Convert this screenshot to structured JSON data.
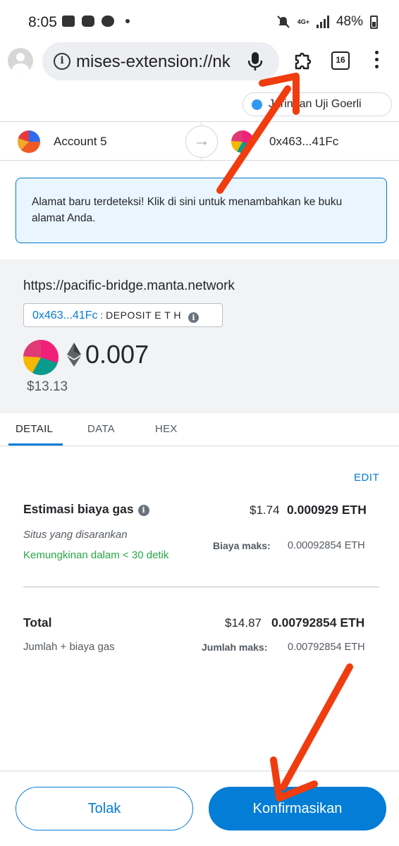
{
  "status_bar": {
    "time": "8:05",
    "network_type": "4G+",
    "battery": "48%"
  },
  "browser": {
    "url": "mises-extension://nk",
    "tab_count": "16"
  },
  "network": {
    "label": "Jaringan Uji Goerli",
    "dot_color": "#3099f2"
  },
  "accounts": {
    "from_name": "Account 5",
    "to_address": "0x463...41Fc"
  },
  "alert": {
    "message": "Alamat baru terdeteksi! Klik di sini untuk menambahkan ke buku alamat Anda."
  },
  "summary": {
    "origin": "https://pacific-bridge.manta.network",
    "method_address": "0x463...41Fc",
    "method_separator": ":",
    "method_name": "DEPOSIT E T H",
    "amount": "0.007",
    "amount_fiat": "$13.13"
  },
  "tabs": [
    {
      "label": "DETAIL"
    },
    {
      "label": "DATA"
    },
    {
      "label": "HEX"
    }
  ],
  "details": {
    "edit_label": "EDIT",
    "gas_label": "Estimasi biaya gas",
    "gas_fiat": "$1.74",
    "gas_eth": "0.000929 ETH",
    "suggested_site": "Situs yang disarankan",
    "likely_time": "Kemungkinan dalam < 30 detik",
    "max_fee_label": "Biaya maks:",
    "max_fee_value": "0.00092854 ETH",
    "total_label": "Total",
    "total_fiat": "$14.87",
    "total_eth": "0.00792854 ETH",
    "total_sub": "Jumlah + biaya gas",
    "max_amount_label": "Jumlah maks:",
    "max_amount_value": "0.00792854 ETH"
  },
  "footer": {
    "reject_label": "Tolak",
    "confirm_label": "Konfirmasikan"
  },
  "colors": {
    "accent": "#037dd6",
    "success": "#28a745",
    "annotation_arrow": "#f03c0f"
  }
}
